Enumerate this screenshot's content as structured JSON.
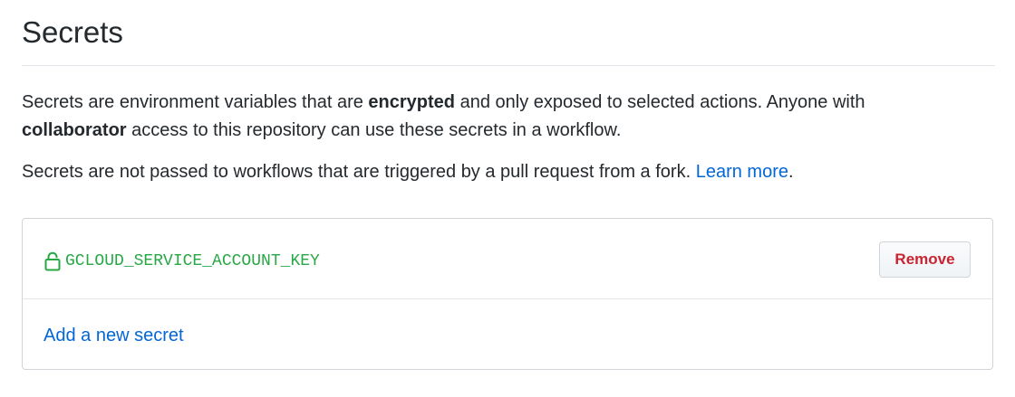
{
  "header": {
    "title": "Secrets"
  },
  "description": {
    "p1_part1": "Secrets are environment variables that are ",
    "p1_bold1": "encrypted",
    "p1_part2": " and only exposed to selected actions. Anyone with ",
    "p1_bold2": "collaborator",
    "p1_part3": " access to this repository can use these secrets in a workflow.",
    "p2_text": "Secrets are not passed to workflows that are triggered by a pull request from a fork. ",
    "p2_link": "Learn more",
    "p2_end": "."
  },
  "secrets": {
    "items": [
      {
        "name": "GCLOUD_SERVICE_ACCOUNT_KEY",
        "icon": "lock-icon",
        "remove_label": "Remove"
      }
    ],
    "add_label": "Add a new secret"
  },
  "colors": {
    "secret_name": "#28a745",
    "remove_text": "#cb2431",
    "link": "#0366d6"
  }
}
